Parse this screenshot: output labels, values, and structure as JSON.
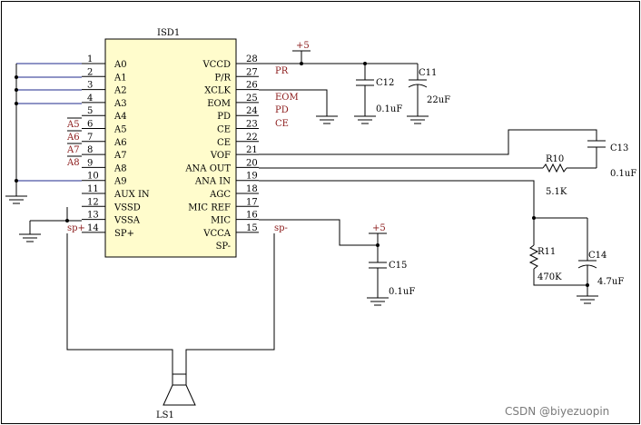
{
  "chip": {
    "designator": "ISD1",
    "left_pins": [
      {
        "num": "1",
        "name": "A0"
      },
      {
        "num": "2",
        "name": "A1"
      },
      {
        "num": "3",
        "name": "A2"
      },
      {
        "num": "4",
        "name": "A3"
      },
      {
        "num": "5",
        "name": "A4"
      },
      {
        "num": "6",
        "name": "A5"
      },
      {
        "num": "7",
        "name": "A6"
      },
      {
        "num": "8",
        "name": "A7"
      },
      {
        "num": "9",
        "name": "A8"
      },
      {
        "num": "10",
        "name": "A9"
      },
      {
        "num": "11",
        "name": "AUX IN"
      },
      {
        "num": "12",
        "name": "VSSD"
      },
      {
        "num": "13",
        "name": "VSSA"
      },
      {
        "num": "14",
        "name": "SP+"
      }
    ],
    "right_pins": [
      {
        "num": "28",
        "name": "VCCD"
      },
      {
        "num": "27",
        "name": "P/R"
      },
      {
        "num": "26",
        "name": "XCLK"
      },
      {
        "num": "25",
        "name": "EOM"
      },
      {
        "num": "24",
        "name": "PD"
      },
      {
        "num": "23",
        "name": "CE"
      },
      {
        "num": "22",
        "name": "CE"
      },
      {
        "num": "21",
        "name": "VOF"
      },
      {
        "num": "20",
        "name": "ANA OUT"
      },
      {
        "num": "19",
        "name": "ANA IN"
      },
      {
        "num": "18",
        "name": "AGC"
      },
      {
        "num": "17",
        "name": "MIC REF"
      },
      {
        "num": "16",
        "name": "MIC"
      },
      {
        "num": "15",
        "name": "VCCA"
      }
    ],
    "bottom_right_pin": "SP-"
  },
  "net_labels": {
    "a5": "A5",
    "a6": "A6",
    "a7": "A7",
    "a8": "A8",
    "pr": "PR",
    "eom": "EOM",
    "pd": "PD",
    "ce": "CE",
    "sp_plus": "sp+",
    "sp_minus": "sp-"
  },
  "power": {
    "vcc_top": "+5",
    "vcc_mid": "+5"
  },
  "components": {
    "c11": {
      "ref": "C11",
      "value": "22uF"
    },
    "c12": {
      "ref": "C12",
      "value": "0.1uF"
    },
    "c13": {
      "ref": "C13",
      "value": "0.1uF"
    },
    "r10": {
      "ref": "R10",
      "value": "5.1K"
    },
    "r11": {
      "ref": "R11",
      "value": "470K"
    },
    "c14": {
      "ref": "C14",
      "value": "4.7uF"
    },
    "c15": {
      "ref": "C15",
      "value": "0.1uF"
    },
    "ls1": {
      "ref": "LS1"
    }
  },
  "watermark": "CSDN @biyezuopin",
  "colors": {
    "frame": "#000000",
    "wire": "#000000",
    "bus": "#1f2a8c",
    "netlabel": "#8b1a1a",
    "chip_fill": "#fffccc"
  }
}
